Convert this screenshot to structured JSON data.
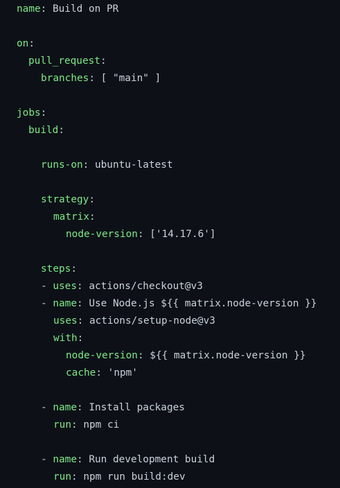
{
  "workflow": {
    "name_key": "name",
    "name_value": "Build on PR",
    "on_key": "on",
    "pull_request_key": "pull_request",
    "branches_key": "branches",
    "branches_value": "[ \"main\" ]",
    "jobs_key": "jobs",
    "build_key": "build",
    "runs_on_key": "runs-on",
    "runs_on_value": "ubuntu-latest",
    "strategy_key": "strategy",
    "matrix_key": "matrix",
    "node_version_key": "node-version",
    "node_version_value": "['14.17.6']",
    "steps_key": "steps",
    "steps": [
      {
        "uses_key": "uses",
        "uses_value": "actions/checkout@v3"
      },
      {
        "name_key": "name",
        "name_value": "Use Node.js ${{ matrix.node-version }}",
        "uses_key": "uses",
        "uses_value": "actions/setup-node@v3",
        "with_key": "with",
        "with_node_version_key": "node-version",
        "with_node_version_value": "${{ matrix.node-version }}",
        "cache_key": "cache",
        "cache_value": "'npm'"
      },
      {
        "name_key": "name",
        "name_value": "Install packages",
        "run_key": "run",
        "run_value": "npm ci"
      },
      {
        "name_key": "name",
        "name_value": "Run development build",
        "run_key": "run",
        "run_value": "npm run build:dev"
      }
    ]
  },
  "colors": {
    "background": "#0d1117",
    "key": "#7ee787",
    "text": "#c9d1d9"
  }
}
